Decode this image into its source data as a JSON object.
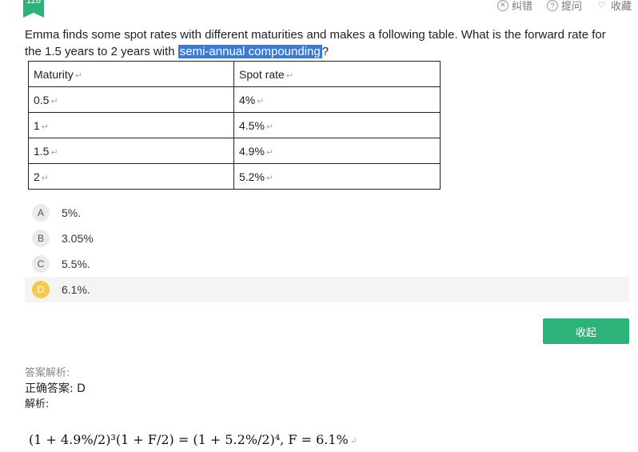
{
  "question_number": "128",
  "toolbar": {
    "report_label": "纠错",
    "ask_label": "提问",
    "favorite_label": "收藏"
  },
  "question": {
    "text_before": "Emma finds some spot rates with different maturities and makes a following table. What is the forward rate for the 1.5 years to 2 years with ",
    "highlight": "semi-annual compounding",
    "text_after": "?"
  },
  "table": {
    "headers": [
      "Maturity",
      "Spot rate"
    ],
    "rows": [
      [
        "0.5",
        "4%"
      ],
      [
        "1",
        "4.5%"
      ],
      [
        "1.5",
        "4.9%"
      ],
      [
        "2",
        "5.2%"
      ]
    ]
  },
  "options": [
    {
      "letter": "A",
      "text": "5%."
    },
    {
      "letter": "B",
      "text": "3.05%"
    },
    {
      "letter": "C",
      "text": "5.5%."
    },
    {
      "letter": "D",
      "text": "6.1%."
    }
  ],
  "selected_option": "D",
  "fold_button_label": "收起",
  "analysis": {
    "label": "答案解析:",
    "correct_answer": "正确答案: D",
    "explanation_label": "解析:",
    "formula": "(1 + 4.9%/2)³(1 + F/2) = (1 + 5.2%/2)⁴, F = 6.1%"
  },
  "colors": {
    "accent_green": "#2db37a",
    "highlight_blue": "#3a7bd5",
    "selected_yellow": "#f5c94a"
  }
}
